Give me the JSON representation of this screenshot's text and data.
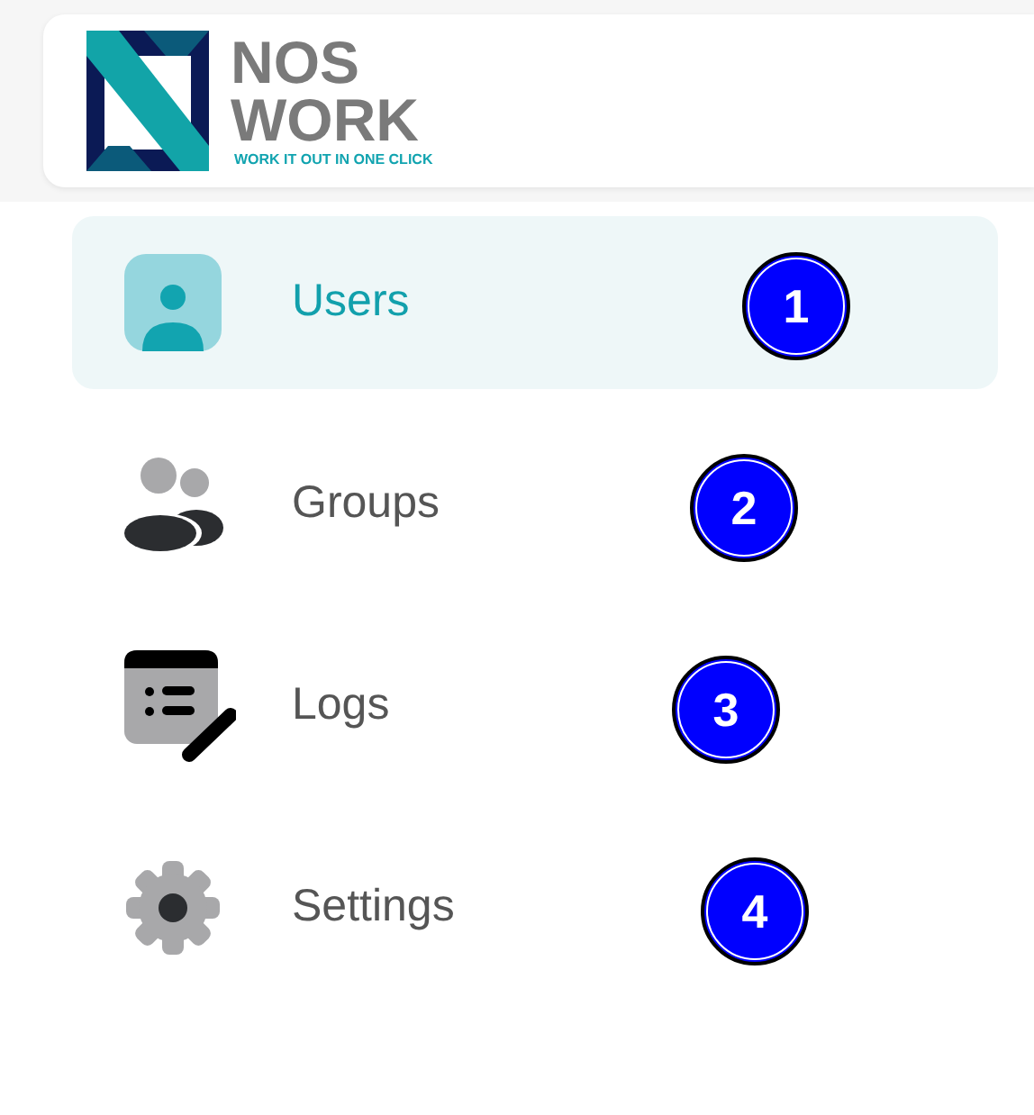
{
  "logo": {
    "line1": "NOS",
    "line2": "WORK",
    "tagline": "WORK IT OUT IN ONE CLICK"
  },
  "menu": [
    {
      "label": "Users",
      "selected": true,
      "badge": "1"
    },
    {
      "label": "Groups",
      "selected": false,
      "badge": "2"
    },
    {
      "label": "Logs",
      "selected": false,
      "badge": "3"
    },
    {
      "label": "Settings",
      "selected": false,
      "badge": "4"
    }
  ]
}
